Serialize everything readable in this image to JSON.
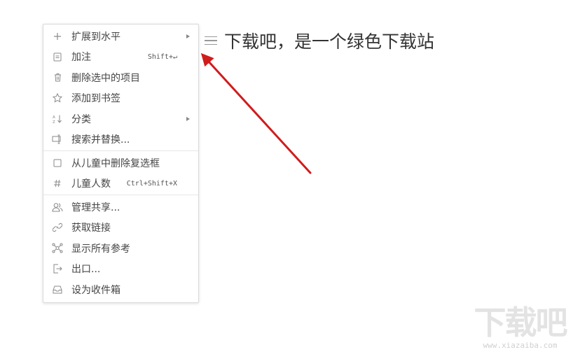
{
  "node": {
    "text": "下载吧，是一个绿色下载站"
  },
  "context_menu": {
    "items": [
      {
        "label": "扩展到水平",
        "icon": "plus-icon",
        "has_submenu": true
      },
      {
        "label": "加注",
        "icon": "note-icon",
        "shortcut": "Shift+↵"
      },
      {
        "label": "删除选中的项目",
        "icon": "trash-icon"
      },
      {
        "label": "添加到书签",
        "icon": "star-icon"
      },
      {
        "label": "分类",
        "icon": "sort-az-icon",
        "has_submenu": true
      },
      {
        "label": "搜索并替换...",
        "icon": "search-replace-icon"
      },
      {
        "label": "从儿童中删除复选框",
        "icon": "checkbox-icon"
      },
      {
        "label": "儿童人数",
        "icon": "hash-icon",
        "shortcut": "Ctrl+Shift+X"
      },
      {
        "label": "管理共享...",
        "icon": "share-users-icon"
      },
      {
        "label": "获取链接",
        "icon": "link-icon"
      },
      {
        "label": "显示所有参考",
        "icon": "references-icon"
      },
      {
        "label": "出口...",
        "icon": "export-icon"
      },
      {
        "label": "设为收件箱",
        "icon": "inbox-icon"
      }
    ]
  },
  "annotation": {
    "arrow_color": "#d01c1c"
  },
  "watermark": {
    "text": "下载吧",
    "url": "www.xiazaiba.com"
  }
}
